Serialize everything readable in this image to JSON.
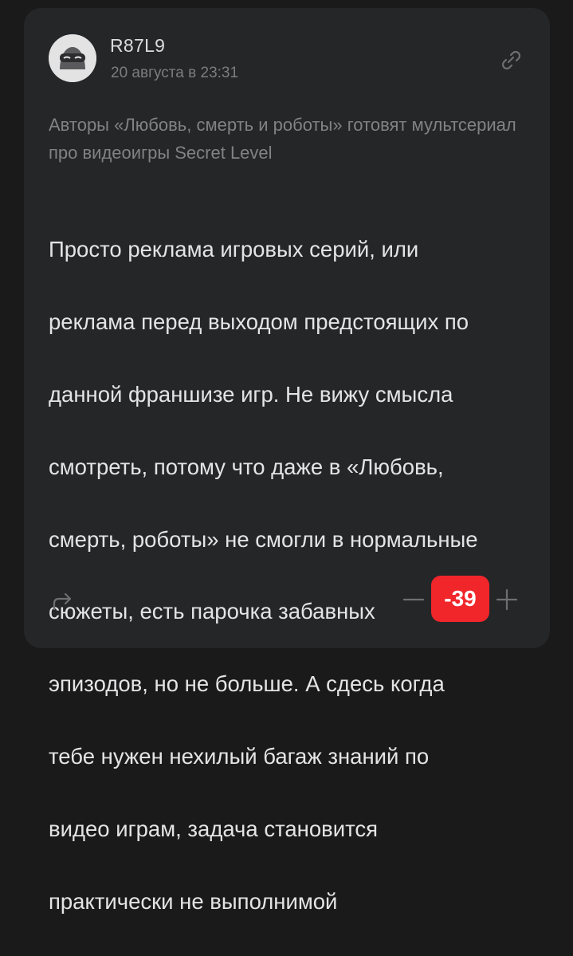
{
  "author": {
    "name": "R87L9",
    "date": "20 августа в 23:31",
    "avatar_icon": "masked-face-avatar-icon"
  },
  "article": {
    "title": "Авторы «Любовь, смерть и роботы» готовят мультсериал про видеоигры Secret Level"
  },
  "comment": {
    "lines": [
      "Просто реклама игровых серий, или",
      "реклама перед выходом предстоящих по",
      "данной франшизе игр. Не вижу смысла",
      "смотреть, потому что даже в «Любовь,",
      "смерть, роботы» не смогли в нормальные",
      "сюжеты, есть парочка забавных",
      "эпизодов, но не больше. А сдесь когда",
      "тебе нужен нехилый багаж знаний по",
      "видео играм, задача становится",
      "практически не выполнимой"
    ]
  },
  "actions": {
    "link_icon": "link-icon",
    "share_icon": "share-arrow-icon",
    "downvote_icon": "minus-icon",
    "upvote_icon": "plus-icon"
  },
  "rating": {
    "score": "-39",
    "badge_color": "#f0262b"
  }
}
